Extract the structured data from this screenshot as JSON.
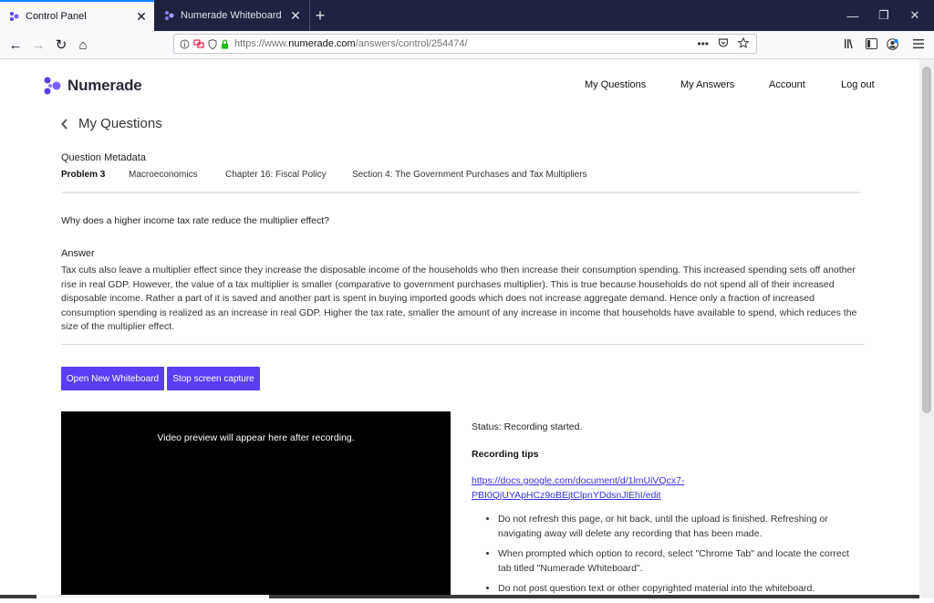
{
  "browser": {
    "tabs": [
      {
        "label": "Control Panel",
        "active": true
      },
      {
        "label": "Numerade Whiteboard",
        "active": false
      }
    ],
    "url_prefix": "https://www.",
    "url_domain": "numerade.com",
    "url_path": "/answers/control/254474/",
    "new_tab": "+",
    "win_min": "—",
    "win_restore": "❐",
    "win_close": "✕",
    "tab_close": "✕",
    "more": "•••",
    "back": "←",
    "forward": "→",
    "reload": "↻",
    "home": "⌂"
  },
  "site": {
    "logo_text": "Numerade",
    "nav": [
      "My Questions",
      "My Answers",
      "Account",
      "Log out"
    ],
    "brand_color": "#5b3df5"
  },
  "page": {
    "back_chevron": "‹",
    "title": "My Questions",
    "metadata_heading": "Question Metadata",
    "metadata": {
      "problem": "Problem 3",
      "subject": "Macroeconomics",
      "chapter": "Chapter 16: Fiscal Policy",
      "section": "Section 4: The Government Purchases and Tax Multipliers"
    },
    "question": "Why does a higher income tax rate reduce the multiplier effect?",
    "answer_heading": "Answer",
    "answer": "Tax cuts also leave a multiplier effect since they increase the disposable income of the households who then increase their consumption spending. This increased spending sets off another rise in real GDP. However, the value of a tax multiplier is smaller (comparative to government purchases multiplier). This is true because households do not spend all of their increased disposable income. Rather a part of it is saved and another part is spent in buying imported goods which does not increase aggregate demand. Hence only a fraction of increased consumption spending is realized as an increase in real GDP. Higher the tax rate, smaller the amount of any increase in income that households have available to spend, which reduces the size of the multiplier effect.",
    "buttons": {
      "open_whiteboard": "Open New Whiteboard",
      "stop_capture": "Stop screen capture"
    },
    "video_message": "Video preview will appear here after recording.",
    "status": "Status: Recording started.",
    "tips_heading": "Recording tips",
    "tips_link": "https://docs.google.com/document/d/1lmUiVQcx7-PBI0QjUYApHCz9oBEjtClpnYDdsnJlEhI/edit",
    "tips": [
      "Do not refresh this page, or hit back, until the upload is finished. Refreshing or navigating away will delete any recording that has been made.",
      "When prompted which option to record, select \"Chrome Tab\" and locate the correct tab titled \"Numerade Whiteboard\".",
      "Do not post question text or other copyrighted material into the whiteboard."
    ]
  }
}
